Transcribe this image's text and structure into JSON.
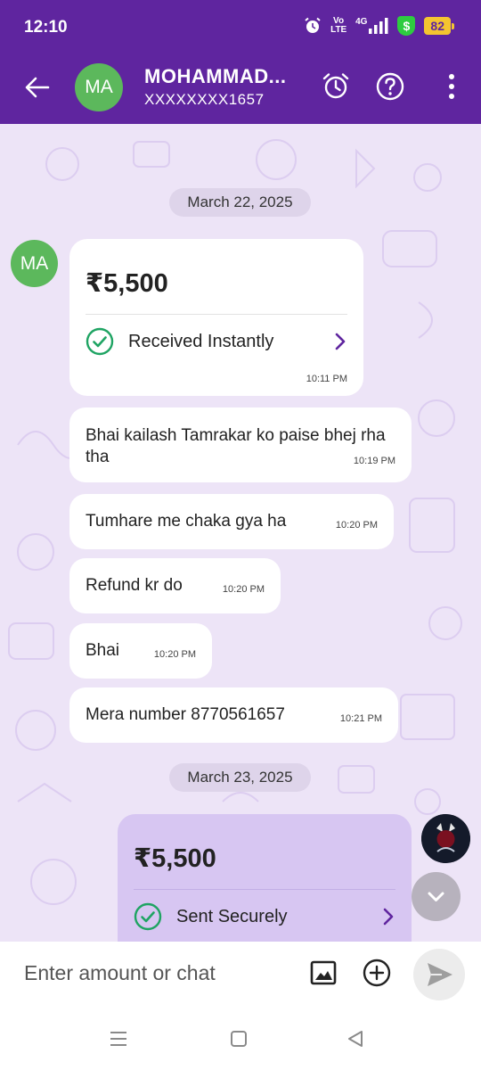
{
  "status_bar": {
    "time": "12:10",
    "volte": "Vo LTE",
    "network": "4G",
    "battery": "82"
  },
  "header": {
    "avatar_initials": "MA",
    "contact_name": "MOHAMMAD...",
    "contact_number": "XXXXXXXX1657"
  },
  "chat": {
    "dates": [
      "March 22, 2025",
      "March 23, 2025"
    ],
    "received_payment": {
      "amount": "₹5,500",
      "status": "Received Instantly",
      "time": "10:11 PM"
    },
    "messages": [
      {
        "text": "Bhai kailash Tamrakar ko paise bhej rha tha",
        "time": "10:19 PM"
      },
      {
        "text": "Tumhare me chaka gya ha",
        "time": "10:20 PM"
      },
      {
        "text": "Refund kr do",
        "time": "10:20 PM"
      },
      {
        "text": "Bhai",
        "time": "10:20 PM"
      },
      {
        "text": "Mera number 8770561657",
        "time": "10:21 PM"
      }
    ],
    "sent_payment": {
      "amount": "₹5,500",
      "status": "Sent Securely"
    }
  },
  "input": {
    "placeholder": "Enter amount or chat"
  },
  "colors": {
    "brand_purple": "#5f259f",
    "chat_background": "#ede4f7",
    "avatar_green": "#5cb85c",
    "sent_card": "#d7c6f2",
    "success_green": "#1fa463"
  },
  "icons": [
    "back-arrow-icon",
    "alarm-icon",
    "help-icon",
    "more-icon",
    "check-circle-icon",
    "chevron-right-icon",
    "chevron-down-icon",
    "image-icon",
    "add-circle-icon",
    "send-icon"
  ]
}
